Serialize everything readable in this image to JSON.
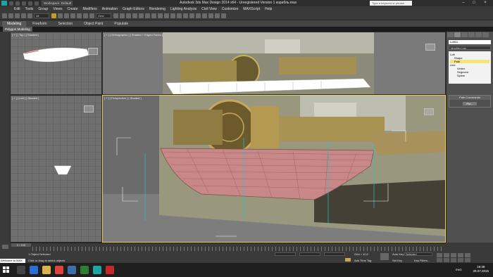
{
  "window": {
    "title": "Autodesk 3ds Max Design 2014 x64 - Unregistered Version  1 корабль.max",
    "workspace": "Workspace: Default",
    "search_placeholder": "Type a keyword or phrase"
  },
  "menu": [
    "Edit",
    "Tools",
    "Group",
    "Views",
    "Create",
    "Modifiers",
    "Animation",
    "Graph Editors",
    "Rendering",
    "Lighting Analysis",
    "Civil View",
    "Customize",
    "MAXScript",
    "Help"
  ],
  "toolbar": {
    "selection_filter": "All",
    "view_dropdown": "View"
  },
  "ribbon": {
    "tabs": [
      "Modeling",
      "Freeform",
      "Selection",
      "Object Paint",
      "Populate"
    ],
    "active_subtab": "Polygon Modeling"
  },
  "viewports": {
    "top": "[ + ] [ Top ] [ Shaded ]",
    "ortho": "[ + ] [ Orthographic ] [ Shaded + Edged Faces ]",
    "left": "[ + ] [ Left ] [ Shaded ]",
    "perspective": "[ + ] [ Perspective ] [ Shaded ]"
  },
  "command_panel": {
    "object_name": "Loft01",
    "modifier_list": "Modifier List",
    "stack": [
      {
        "label": "Loft",
        "level": 0,
        "selected": false
      },
      {
        "label": "Shape",
        "level": 1,
        "selected": false
      },
      {
        "label": "Path",
        "level": 1,
        "selected": true
      },
      {
        "label": "Line",
        "level": 0,
        "selected": false
      },
      {
        "label": "Vertex",
        "level": 1,
        "selected": false
      },
      {
        "label": "Segment",
        "level": 1,
        "selected": false
      },
      {
        "label": "Spline",
        "level": 1,
        "selected": false
      }
    ],
    "rollout_title": "Path Commands",
    "put_button": "Put..."
  },
  "timeline": {
    "frame": "0 / 100"
  },
  "status": {
    "selected": "1 Object Selected",
    "prompt": "Click or drag to select objects",
    "grid": "Grid = 10,0",
    "auto_key": "Auto Key",
    "key_mode": "Selected",
    "set_key": "Set Key",
    "key_filters": "Key Filters...",
    "add_time_tag": "Add Time Tag",
    "maxscript": "Welcome to MAX"
  },
  "taskbar": {
    "time": "19:39",
    "date": "28.07.2015",
    "lang": "ENG"
  },
  "colors": {
    "accent_active_viewport": "#e8d33a",
    "hull_pink": "#c98888",
    "cyan_app": "#1fa4a4"
  }
}
